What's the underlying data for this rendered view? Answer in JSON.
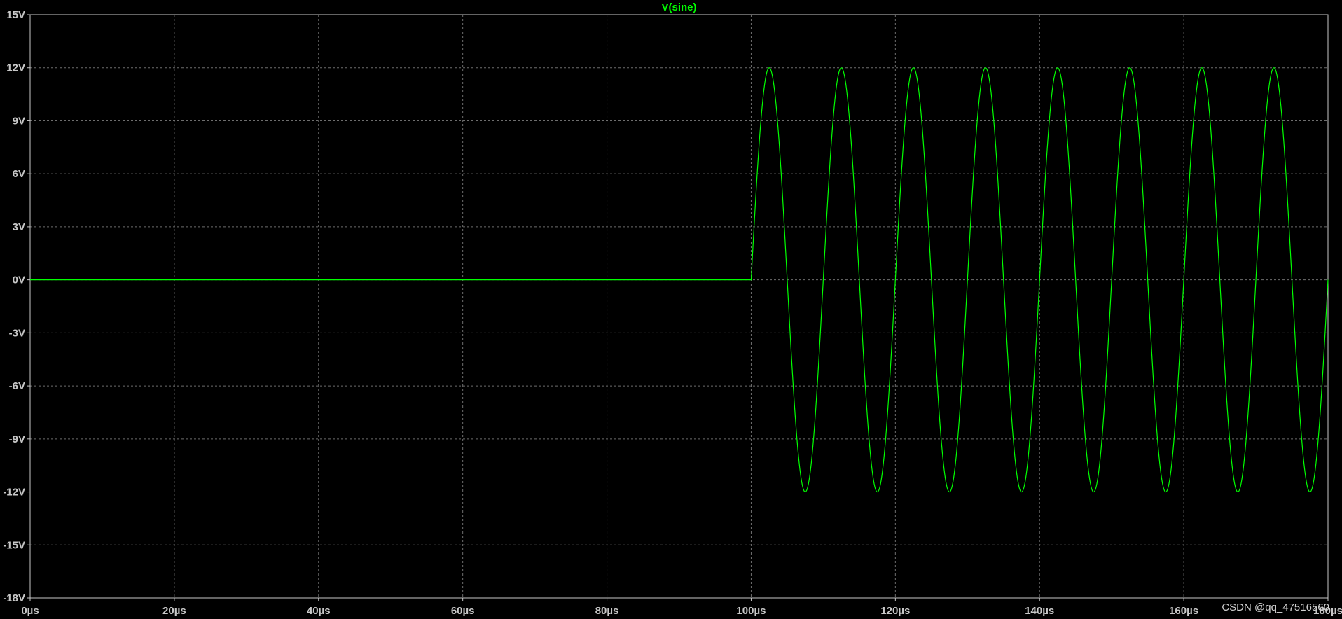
{
  "chart_data": {
    "type": "line",
    "title": "V(sine)",
    "xlabel": "",
    "ylabel": "",
    "xlim": [
      0,
      180
    ],
    "ylim": [
      -18,
      15
    ],
    "x_ticks": [
      0,
      20,
      40,
      60,
      80,
      100,
      120,
      140,
      160,
      180
    ],
    "x_tick_labels": [
      "0µs",
      "20µs",
      "40µs",
      "60µs",
      "80µs",
      "100µs",
      "120µs",
      "140µs",
      "160µs",
      "180µs"
    ],
    "y_ticks": [
      15,
      12,
      9,
      6,
      3,
      0,
      -3,
      -6,
      -9,
      -12,
      -15,
      -18
    ],
    "y_tick_labels": [
      "15V",
      "12V",
      "9V",
      "6V",
      "3V",
      "0V",
      "-3V",
      "-6V",
      "-9V",
      "-12V",
      "-15V",
      "-18V"
    ],
    "grid": true,
    "series": [
      {
        "name": "V(sine)",
        "color": "#00ff00",
        "segments": [
          {
            "kind": "constant",
            "x_start": 0,
            "x_end": 100,
            "value": 0
          },
          {
            "kind": "sine",
            "x_start": 100,
            "x_end": 180,
            "amplitude": 12,
            "frequency_per_us": 0.1,
            "offset": 0
          }
        ]
      }
    ]
  },
  "colors": {
    "background": "#000000",
    "axis": "#c8c8c8",
    "grid": "#6e6e6e",
    "trace": "#00ff00"
  },
  "watermark": "CSDN @qq_47516560"
}
